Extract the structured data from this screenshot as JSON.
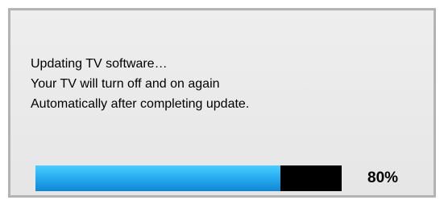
{
  "dialog": {
    "lines": [
      "Updating TV software…",
      "Your TV will turn off and on again",
      "Automatically after completing update."
    ],
    "progress": {
      "value": 0.8,
      "label": "80%",
      "fill_color": "#1ea3eb",
      "track_color": "#000000"
    }
  }
}
